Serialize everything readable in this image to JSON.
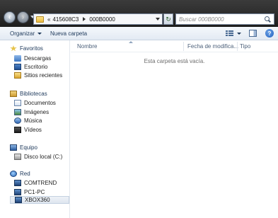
{
  "address_bar": {
    "overflow_chevron": "«",
    "crumbs": [
      "415608C3",
      "000B0000"
    ]
  },
  "search": {
    "placeholder": "Buscar 000B0000"
  },
  "toolbar": {
    "organize_label": "Organizar",
    "new_folder_label": "Nueva carpeta",
    "help_glyph": "?"
  },
  "nav_pane": {
    "favorites": {
      "label": "Favoritos",
      "items": [
        "Descargas",
        "Escritorio",
        "Sitios recientes"
      ]
    },
    "libraries": {
      "label": "Bibliotecas",
      "items": [
        "Documentos",
        "Imágenes",
        "Música",
        "Vídeos"
      ]
    },
    "computer": {
      "label": "Equipo",
      "items": [
        "Disco local (C:)"
      ]
    },
    "network": {
      "label": "Red",
      "items": [
        "COMTREND",
        "PC1-PC",
        "XBOX360"
      ],
      "selected": "XBOX360"
    }
  },
  "content": {
    "columns": [
      "Nombre",
      "Fecha de modifica...",
      "Tipo"
    ],
    "empty_message": "Esta carpeta está vacía."
  },
  "colors": {
    "accent": "#1e395b",
    "topbar": "#2b2b2b",
    "selection": "#dde5ef"
  }
}
